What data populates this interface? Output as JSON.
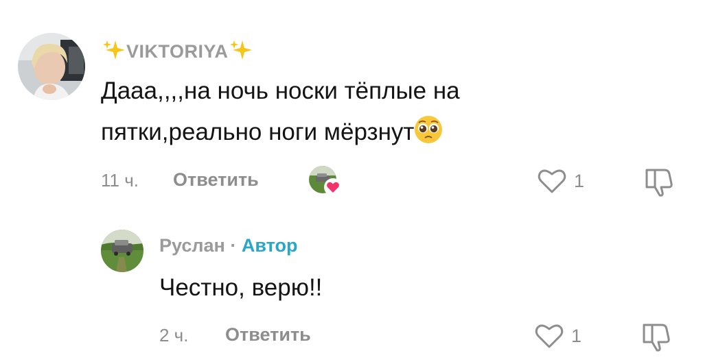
{
  "comment": {
    "username": "VIKTORIYA",
    "text_line1": "Дааа,,,,на ночь носки тёплые на",
    "text_line2": "пятки,реально ноги мёрзнут",
    "time": "11 ч.",
    "reply_label": "Ответить",
    "like_count": "1"
  },
  "reply": {
    "username": "Руслан",
    "separator": "·",
    "author_label": "Автор",
    "text": "Честно, верю!!",
    "time": "2 ч.",
    "reply_label": "Ответить",
    "like_count": "1"
  },
  "colors": {
    "meta_gray": "#8d8d8d",
    "author_blue": "#2aa6c8",
    "heart_badge": "#f0356b",
    "sparkle": "#f5c518"
  },
  "icons": [
    "sparkle-icon",
    "pleading-face-emoji",
    "heart-outline-icon",
    "dislike-icon",
    "creator-liked-heart-icon"
  ]
}
